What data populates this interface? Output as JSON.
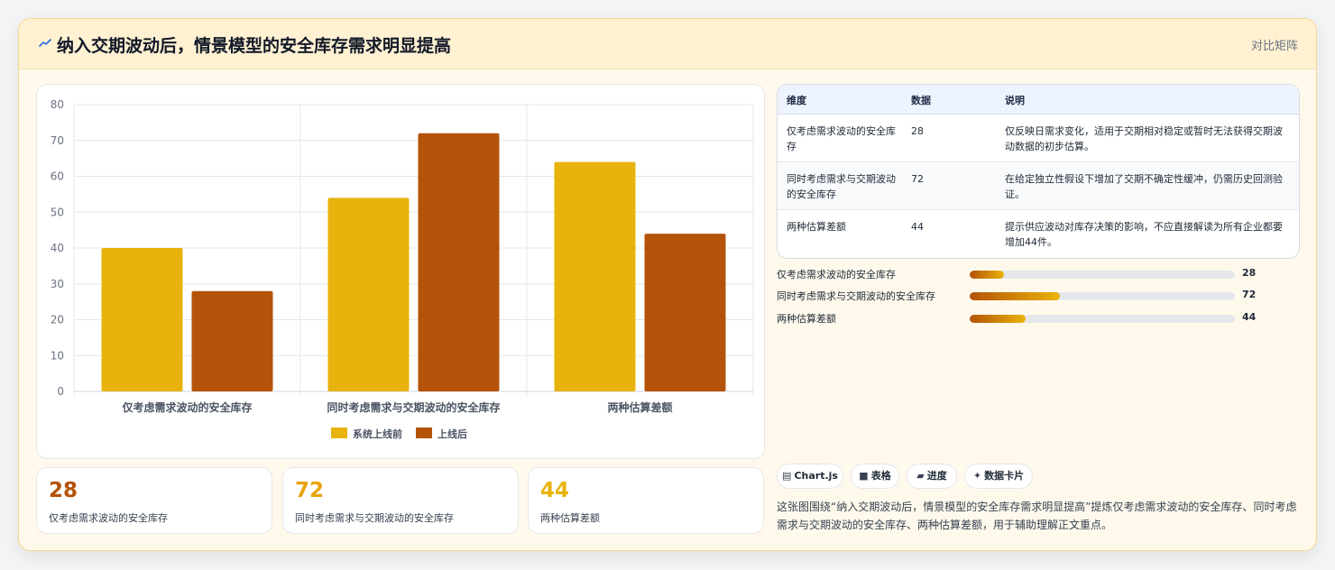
{
  "header": {
    "title": "纳入交期波动后，情景模型的安全库存需求明显提高",
    "link": "对比矩阵"
  },
  "colors": {
    "before": "#e8b30c",
    "after": "#b45309",
    "accent_orange": "#b45309",
    "accent_gold": "#eab308"
  },
  "chart_data": {
    "type": "bar",
    "categories": [
      "仅考虑需求波动的安全库存",
      "同时考虑需求与交期波动的安全库存",
      "两种估算差额"
    ],
    "series": [
      {
        "name": "系统上线前",
        "values": [
          40,
          54,
          64
        ],
        "color": "#e8b30c"
      },
      {
        "name": "上线后",
        "values": [
          28,
          72,
          44
        ],
        "color": "#b45309"
      }
    ],
    "ylim": [
      0,
      80
    ],
    "yticks": [
      0,
      10,
      20,
      30,
      40,
      50,
      60,
      70,
      80
    ],
    "grid": true,
    "legend": "bottom"
  },
  "stats": [
    {
      "value": "28",
      "label": "仅考虑需求波动的安全库存",
      "color": "#b45309"
    },
    {
      "value": "72",
      "label": "同时考虑需求与交期波动的安全库存",
      "color": "#e8a20c"
    },
    {
      "value": "44",
      "label": "两种估算差额",
      "color": "#e8b30c"
    }
  ],
  "table": {
    "headers": [
      "维度",
      "数据",
      "说明"
    ],
    "rows": [
      {
        "dim": "仅考虑需求波动的安全库存",
        "value": "28",
        "desc": "仅反映日需求变化，适用于交期相对稳定或暂时无法获得交期波动数据的初步估算。"
      },
      {
        "dim": "同时考虑需求与交期波动的安全库存",
        "value": "72",
        "desc": "在给定独立性假设下增加了交期不确定性缓冲，仍需历史回测验证。"
      },
      {
        "dim": "两种估算差额",
        "value": "44",
        "desc": "提示供应波动对库存决策的影响，不应直接解读为所有企业都要增加44件。"
      }
    ]
  },
  "progress": [
    {
      "label": "仅考虑需求波动的安全库存",
      "value": "28",
      "fraction": 0.13
    },
    {
      "label": "同时考虑需求与交期波动的安全库存",
      "value": "72",
      "fraction": 0.34
    },
    {
      "label": "两种估算差额",
      "value": "44",
      "fraction": 0.21
    }
  ],
  "tags": [
    {
      "icon": "chart-icon",
      "glyph": "▤",
      "label": "Chart.js"
    },
    {
      "icon": "table-icon",
      "glyph": "■",
      "label": "表格"
    },
    {
      "icon": "progress-icon",
      "glyph": "▰",
      "label": "进度"
    },
    {
      "icon": "sparkle-icon",
      "glyph": "✦",
      "label": "数据卡片"
    }
  ],
  "summary": "这张图围绕“纳入交期波动后，情景模型的安全库存需求明显提高”提炼仅考虑需求波动的安全库存、同时考虑需求与交期波动的安全库存、两种估算差额，用于辅助理解正文重点。"
}
